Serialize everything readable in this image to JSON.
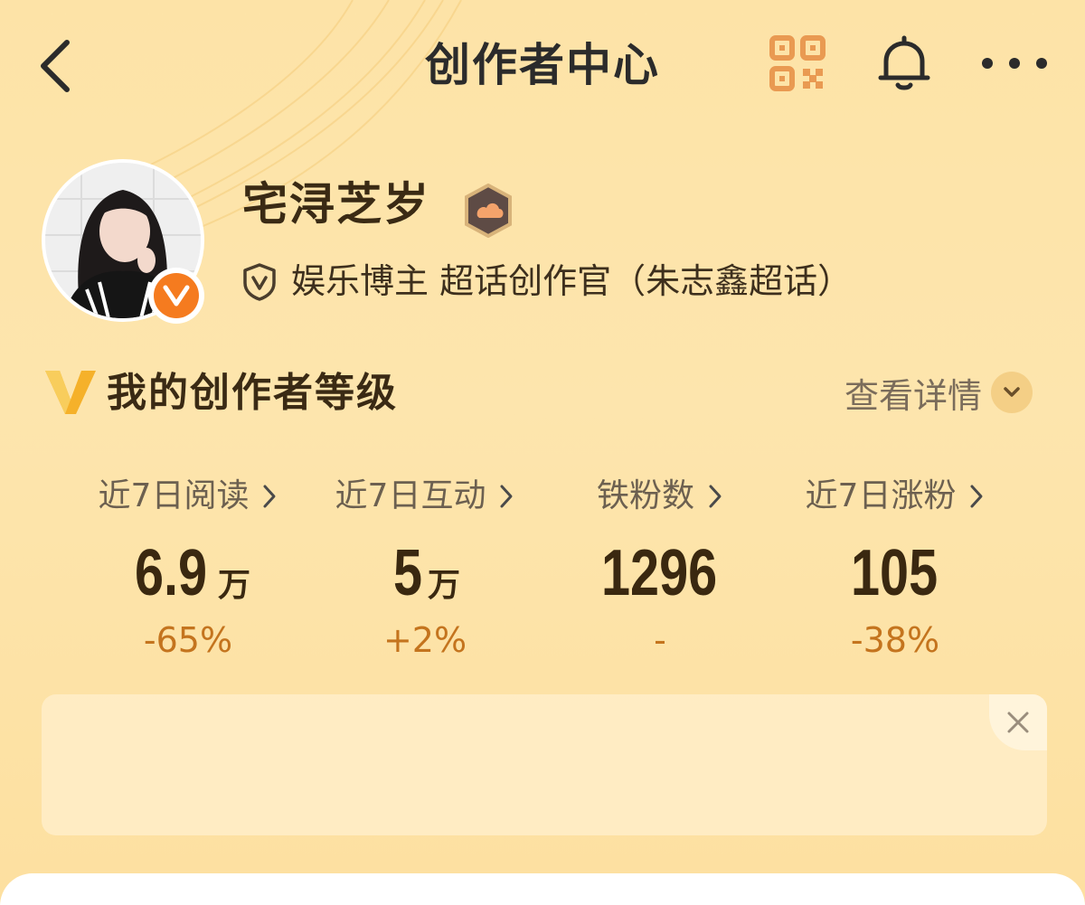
{
  "header": {
    "title": "创作者中心",
    "back_icon": "chevron-left-icon",
    "qr_icon": "qr-code-icon",
    "bell_icon": "bell-icon",
    "more_icon": "more-dots-icon"
  },
  "profile": {
    "name": "宅浔芝岁",
    "verified_badge": "V",
    "certification": "娱乐博主 超话创作官（朱志鑫超话）"
  },
  "creator_level": {
    "title": "我的创作者等级",
    "details_label": "查看详情"
  },
  "stats": [
    {
      "label": "近7日阅读",
      "value": "6.9",
      "unit": "万",
      "change": "-65%"
    },
    {
      "label": "近7日互动",
      "value": "5",
      "unit": "万",
      "change": "+2%"
    },
    {
      "label": "铁粉数",
      "value": "1296",
      "unit": "",
      "change": "-"
    },
    {
      "label": "近7日涨粉",
      "value": "105",
      "unit": "",
      "change": "-38%"
    }
  ],
  "colors": {
    "background": "#fde3a7",
    "accent_orange": "#f57b1f",
    "change_text": "#c4741e",
    "qr_icon": "#e99a52"
  }
}
